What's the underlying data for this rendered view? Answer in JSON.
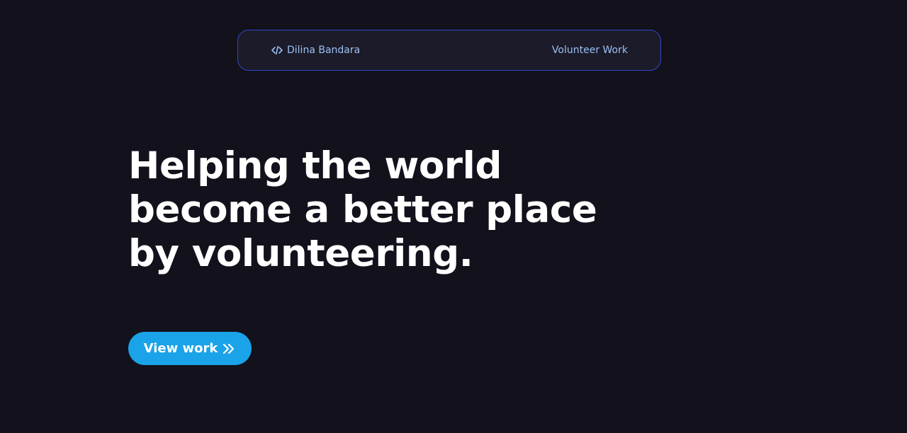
{
  "nav": {
    "brand_icon": "code-icon",
    "brand_name": "Dilina Bandara",
    "link_label": "Volunteer Work"
  },
  "hero": {
    "title_lines": [
      "Helping the world",
      "become a better place",
      "by volunteering."
    ]
  },
  "cta": {
    "label": "View work",
    "icon": "double-chevron-right-icon"
  },
  "colors": {
    "background": "#12111c",
    "nav_background": "#1c1b29",
    "nav_border": "#2f49c9",
    "nav_text": "#9cc0f3",
    "accent": "#1aa3e8",
    "title": "#ffffff"
  }
}
